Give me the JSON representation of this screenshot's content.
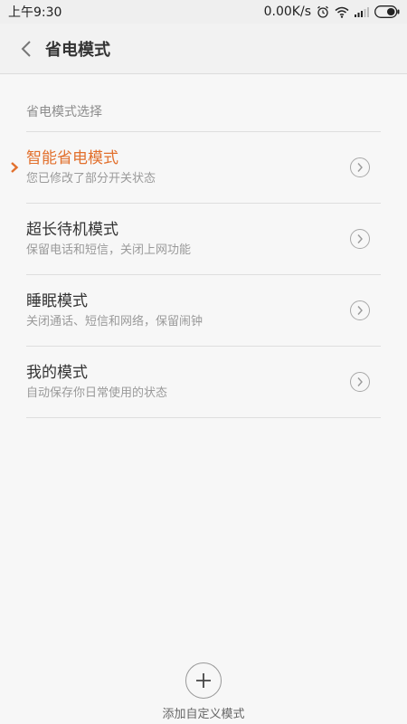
{
  "status_bar": {
    "time": "上午9:30",
    "speed": "0.00K/s",
    "icons": [
      "alarm-icon",
      "wifi-icon",
      "signal-icon",
      "battery-icon"
    ]
  },
  "header": {
    "title": "省电模式",
    "back_icon": "chevron-left-icon"
  },
  "section": {
    "label": "省电模式选择"
  },
  "modes": [
    {
      "title": "智能省电模式",
      "subtitle": "您已修改了部分开关状态",
      "active": true
    },
    {
      "title": "超长待机模式",
      "subtitle": "保留电话和短信，关闭上网功能",
      "active": false
    },
    {
      "title": "睡眠模式",
      "subtitle": "关闭通话、短信和网络，保留闹钟",
      "active": false
    },
    {
      "title": "我的模式",
      "subtitle": "自动保存你日常使用的状态",
      "active": false
    }
  ],
  "add": {
    "label": "添加自定义模式",
    "icon": "plus-icon"
  },
  "colors": {
    "accent": "#e2702d",
    "background": "#f7f7f7",
    "divider": "#dedede"
  }
}
